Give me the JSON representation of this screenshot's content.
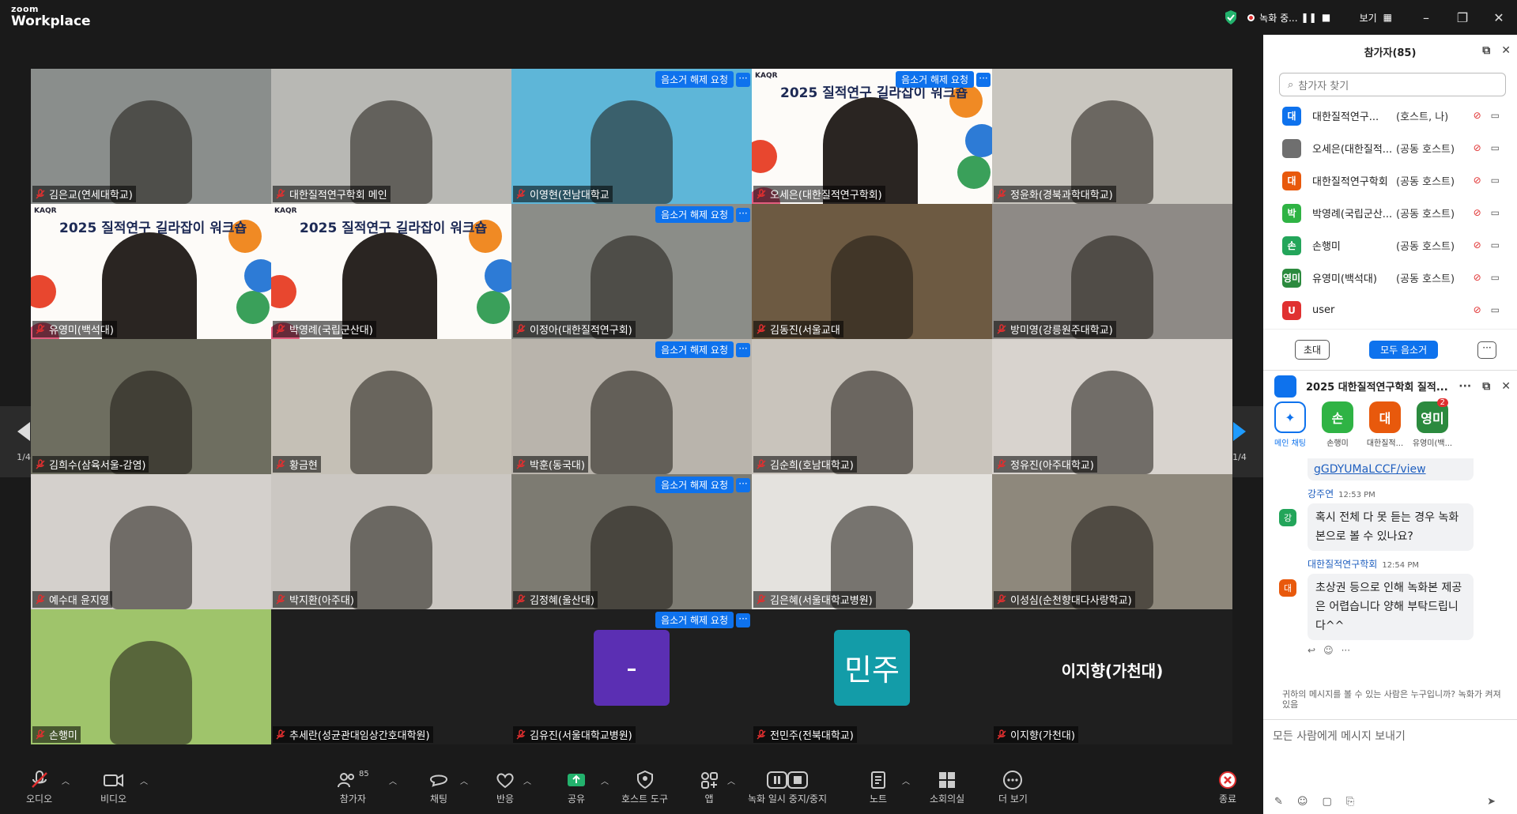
{
  "app": {
    "brand_top": "zoom",
    "brand_bottom": "Workplace",
    "recording_label": "녹화 중...",
    "view_label": "보기"
  },
  "nav": {
    "page": "1/4"
  },
  "tiles": [
    {
      "name": "김은교(연세대학교)",
      "bg": "#8a8e8c"
    },
    {
      "name": "대한질적연구학회 메인",
      "bg": "#b8b8b4"
    },
    {
      "name": "이영현(전남대학교",
      "bg": "#5eb6d8",
      "unmute": true
    },
    {
      "name": "오세은(대한질적연구학회)",
      "banner": true,
      "unmute": true,
      "active": true
    },
    {
      "name": "정윤화(경북과학대학교)",
      "bg": "#c9c6bf"
    },
    {
      "name": "유영미(백석대)",
      "banner": true
    },
    {
      "name": "박영례(국립군산대)",
      "banner": true
    },
    {
      "name": "이정아(대한질적연구회)",
      "bg": "#8b8d88",
      "unmute": true
    },
    {
      "name": "김동진(서울교대",
      "bg": "#6d5a42"
    },
    {
      "name": "방미영(강릉원주대학교)",
      "bg": "#8e8a86"
    },
    {
      "name": "김희수(삼육서울-감염)",
      "bg": "#6e6e60"
    },
    {
      "name": "황금현",
      "bg": "#c5c0b6"
    },
    {
      "name": "박훈(동국대)",
      "bg": "#b9b4ac",
      "unmute": true
    },
    {
      "name": "김순희(호남대학교)",
      "bg": "#c9c4bc"
    },
    {
      "name": "정유진(아주대학교)",
      "bg": "#d8d3ce"
    },
    {
      "name": "예수대 윤지영",
      "bg": "#d4d0cc"
    },
    {
      "name": "박지환(아주대)",
      "bg": "#cbc7c2"
    },
    {
      "name": "김정혜(울산대)",
      "bg": "#7d7b72",
      "unmute": true
    },
    {
      "name": "김은혜(서울대학교병원)",
      "bg": "#e4e2de"
    },
    {
      "name": "이성심(순천향대다사랑학교)",
      "bg": "#8e887c"
    },
    {
      "name": "손행미",
      "bg": "#9fc46b"
    },
    {
      "name": "추세란(성균관대임상간호대학원)",
      "bg": "#1f1f1f"
    },
    {
      "name": "김유진(서울대학교병원)",
      "bg": "#1f1f1f",
      "avatar": "-",
      "avatar_color": "#5b2fb3",
      "unmute": true
    },
    {
      "name": "전민주(전북대학교)",
      "bg": "#1f1f1f",
      "avatar": "민주",
      "avatar_color": "#139ca8"
    },
    {
      "name": "이지향(가천대)",
      "bg": "#1f1f1f",
      "bigname": "이지향(가천대)"
    }
  ],
  "banner": {
    "title": "2025 질적연구 길라잡이 워크숍",
    "org": "KAQR"
  },
  "unmute_label": "음소거 해제 요청",
  "toolbar": {
    "audio": "오디오",
    "video": "비디오",
    "participants": "참가자",
    "participants_count": "85",
    "chat": "채팅",
    "react": "반응",
    "share": "공유",
    "host_tools": "호스트 도구",
    "apps": "앱",
    "pause_rec": "녹화 일시 중지/중지",
    "notes": "노트",
    "breakout": "소회의실",
    "more": "더 보기",
    "end": "종료"
  },
  "panel": {
    "title": "참가자(85)",
    "search_placeholder": "참가자 찾기",
    "participants": [
      {
        "initial": "대",
        "name": "대한질적연구...",
        "role": "(호스트, 나)",
        "color": "#0e72ed"
      },
      {
        "initial": "",
        "name": "오세은(대한질적...",
        "role": "(공동 호스트)",
        "color": "#6f6f6f"
      },
      {
        "initial": "대",
        "name": "대한질적연구학회",
        "role": "(공동 호스트)",
        "color": "#e8590c"
      },
      {
        "initial": "박",
        "name": "박영례(국립군산...",
        "role": "(공동 호스트)",
        "color": "#2fb344"
      },
      {
        "initial": "손",
        "name": "손행미",
        "role": "(공동 호스트)",
        "color": "#23a55a"
      },
      {
        "initial": "영미",
        "name": "유영미(백석대)",
        "role": "(공동 호스트)",
        "color": "#2b8a3e"
      },
      {
        "initial": "U",
        "name": "user",
        "role": "",
        "color": "#e03131"
      }
    ],
    "invite": "초대",
    "mute_all": "모두 음소거",
    "chat_title": "2025 대한질적연구학회 질적...",
    "chat_tabs": [
      {
        "label": "메인 채팅",
        "initial": "",
        "color": "#0e72ed"
      },
      {
        "label": "손행미",
        "initial": "손",
        "color": "#2fb344"
      },
      {
        "label": "대한질적...",
        "initial": "대",
        "color": "#e8590c"
      },
      {
        "label": "유영미(백...",
        "initial": "영미",
        "color": "#2b8a3e",
        "badge": "2"
      }
    ],
    "link_text": "gGDYUMaLCCF/view",
    "messages": [
      {
        "sender": "강주연",
        "time": "12:53 PM",
        "initial": "강",
        "color": "#23a55a",
        "text": "혹시 전체 다 못 듣는 경우 녹화본으로 볼 수 있나요?"
      },
      {
        "sender": "대한질적연구학회",
        "time": "12:54 PM",
        "initial": "대",
        "color": "#e8590c",
        "text": "초상권 등으로 인해 녹화본 제공은 어렵습니다 양해 부탁드립니다^^"
      }
    ],
    "notice": "귀하의 메시지를 볼 수 있는 사람은 누구입니까? 녹화가 켜져 있음",
    "input_placeholder": "모든 사람에게 메시지 보내기"
  }
}
